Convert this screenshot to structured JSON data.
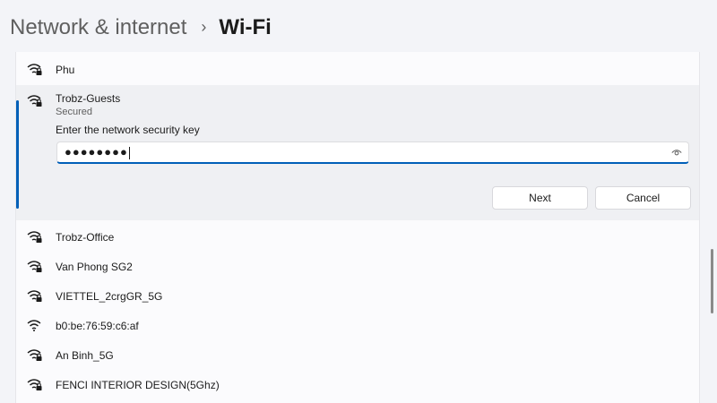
{
  "header": {
    "parent": "Network & internet",
    "separator": "›",
    "current": "Wi-Fi"
  },
  "networks_above": [
    {
      "ssid": "Phu",
      "icon": "wifi-secured-icon"
    }
  ],
  "selected_network": {
    "ssid": "Trobz-Guests",
    "status": "Secured",
    "prompt": "Enter the network security key",
    "password_masked": "●●●●●●●●",
    "next_label": "Next",
    "cancel_label": "Cancel",
    "icon": "wifi-secured-icon"
  },
  "networks_below": [
    {
      "ssid": "Trobz-Office",
      "icon": "wifi-secured-icon"
    },
    {
      "ssid": "Van Phong SG2",
      "icon": "wifi-secured-icon"
    },
    {
      "ssid": "VIETTEL_2crgGR_5G",
      "icon": "wifi-secured-icon"
    },
    {
      "ssid": "b0:be:76:59:c6:af",
      "icon": "wifi-open-icon"
    },
    {
      "ssid": "An Binh_5G",
      "icon": "wifi-secured-icon"
    },
    {
      "ssid": "FENCI INTERIOR DESIGN(5Ghz)",
      "icon": "wifi-secured-icon"
    }
  ],
  "colors": {
    "accent": "#005fb8",
    "background": "#f3f4f8",
    "panel": "#fbfbfd",
    "expanded_panel": "#eff0f3"
  }
}
